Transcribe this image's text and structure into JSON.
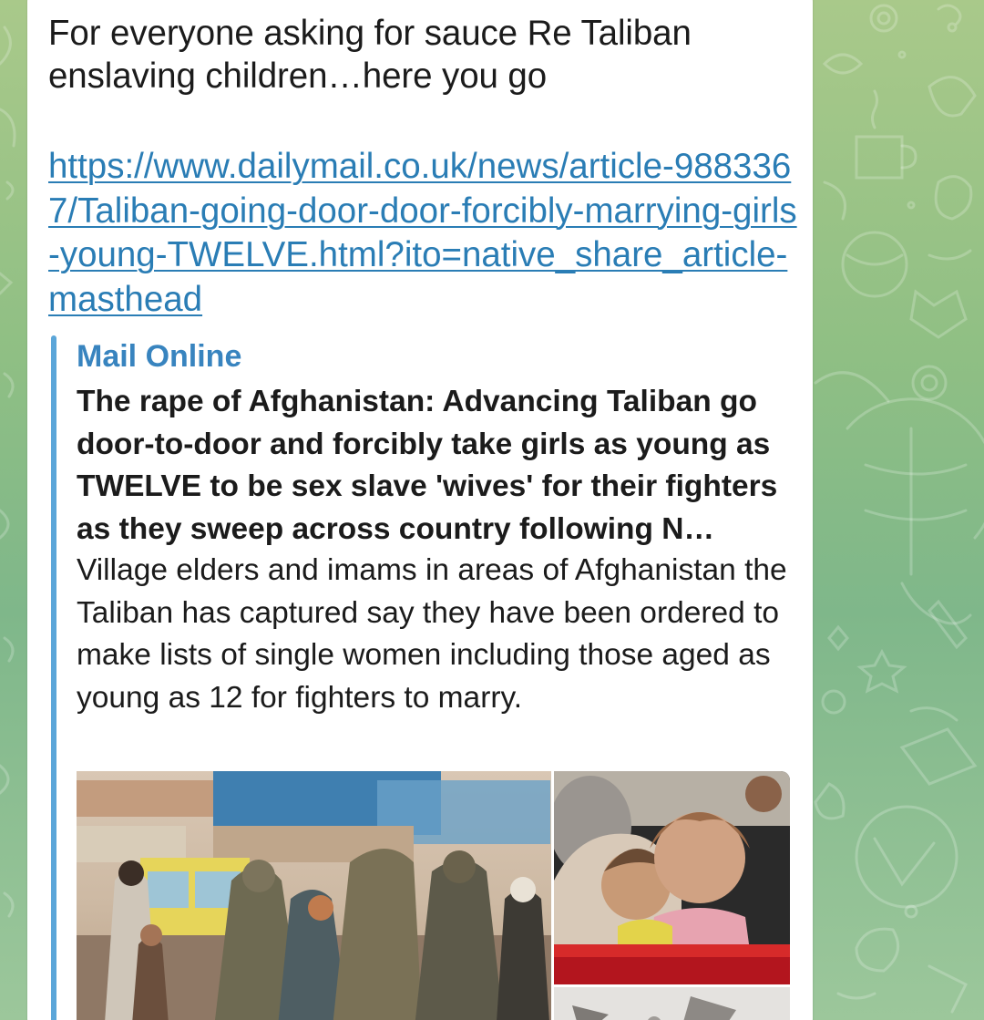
{
  "message": {
    "text": "For everyone asking for sauce Re Taliban enslaving children…here you go",
    "link": "https://www.dailymail.co.uk/news/article-9883367/Taliban-going-door-door-forcibly-marrying-girls-young-TWELVE.html?ito=native_share_article-masthead"
  },
  "link_preview": {
    "site_name": "Mail Online",
    "title": "The rape of Afghanistan: Advancing Taliban go door-to-door and forcibly take girls as young as TWELVE to be sex slave 'wives' for their fighters as they sweep across country following N…",
    "description": "Village elders and imams in areas of Afghanistan the Taliban has captured say they have been ordered to make lists of single women including those aged as young as 12 for fighters to marry."
  },
  "colors": {
    "link": "#2a7db5",
    "site_name": "#3884bf",
    "preview_bar": "#5ba6d9",
    "bubble": "#ffffff",
    "wallpaper": "#8fbf84"
  },
  "icons": [
    "wallpaper-doodle-pattern"
  ]
}
